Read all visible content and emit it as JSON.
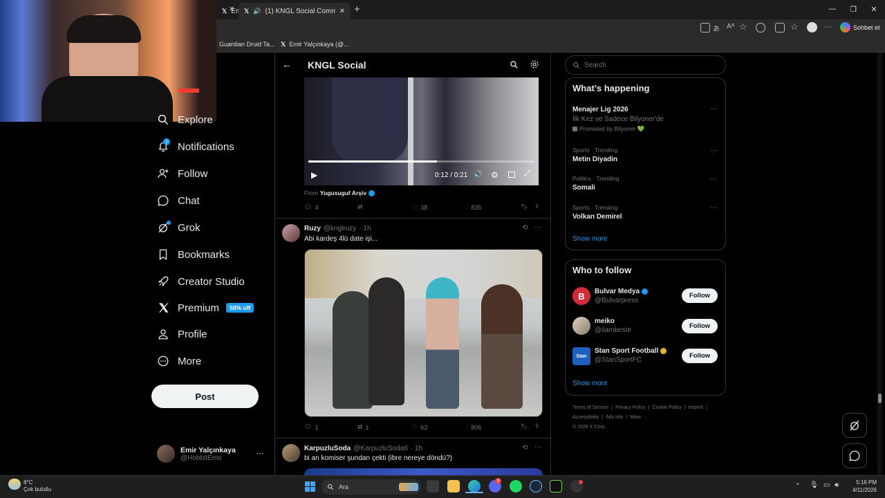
{
  "browser": {
    "tabs": [
      {
        "label": "Emi"
      },
      {
        "label": "(1) KNGL Social Community /"
      }
    ],
    "favorites": [
      {
        "label": "Guardian Druid Ta..."
      },
      {
        "label": "Emir Yalçınkaya (@..."
      }
    ],
    "copilot_label": "Sohbet et"
  },
  "nav": {
    "items": [
      {
        "label": "Explore"
      },
      {
        "label": "Notifications",
        "count": "1"
      },
      {
        "label": "Follow"
      },
      {
        "label": "Chat"
      },
      {
        "label": "Grok"
      },
      {
        "label": "Bookmarks"
      },
      {
        "label": "Creator Studio"
      },
      {
        "label": "Premium",
        "badge": "50% off"
      },
      {
        "label": "Profile"
      },
      {
        "label": "More"
      }
    ],
    "post_label": "Post",
    "account": {
      "name": "Emir Yalçınkaya",
      "handle": "@HobbitEmo"
    }
  },
  "header": {
    "title": "KNGL Social"
  },
  "video": {
    "time": "0:12 / 0:21",
    "progress": 0.57
  },
  "tweet1": {
    "from_prefix": "From",
    "from_name": "Yugusuguf Arşiv",
    "replies": "4",
    "retweets": "",
    "likes": "38",
    "views": "835"
  },
  "tweet2": {
    "name": "Ruzy",
    "handle": "@knglruzy",
    "time": "· 1h",
    "text": "Abi kardeş 4lü date işi...",
    "replies": "1",
    "retweets": "1",
    "likes": "63",
    "views": "806"
  },
  "tweet3": {
    "name": "KarpuzluSoda",
    "handle": "@KarpuzluSoda6",
    "time": "· 1h",
    "text": "bi an komiser şundan çekti (ibre nereye döndü?)"
  },
  "sidebar": {
    "search_placeholder": "Search",
    "happening": {
      "title": "What’s happening",
      "items": [
        {
          "title": "Menajer Lig 2026",
          "subtitle": "İlk Kez ve Sadece Bilyoner'de",
          "meta": "Promoted by Bilyoner 💚"
        },
        {
          "meta": "Sports · Trending",
          "title": "Metin Diyadin"
        },
        {
          "meta": "Politics · Trending",
          "title": "Somali"
        },
        {
          "meta": "Sports · Trending",
          "title": "Volkan Demirel"
        }
      ],
      "show_more": "Show more"
    },
    "who_to_follow": {
      "title": "Who to follow",
      "items": [
        {
          "name": "Bulvar Medya",
          "handle": "@Bulvarpress",
          "button": "Follow"
        },
        {
          "name": "meiko",
          "handle": "@iiambeste",
          "button": "Follow"
        },
        {
          "name": "Stan Sport Football",
          "handle": "@StanSportFC",
          "button": "Follow"
        }
      ],
      "show_more": "Show more"
    },
    "footer": {
      "links": [
        "Terms of Service",
        "Privacy Policy",
        "Cookie Policy",
        "Imprint",
        "Accessibility",
        "Ads info",
        "More ···"
      ],
      "copyright": "© 2026 X Corp."
    }
  },
  "taskbar": {
    "weather_temp": "8°C",
    "weather_desc": "Çok bulutlu",
    "search_label": "Ara",
    "time": "5:16 PM",
    "date": "4/11/2026",
    "discord_count": "9"
  },
  "colors": {
    "accent": "#1d9bf0",
    "background": "#000000",
    "verified": "#1d9bf0",
    "gold": "#e2b719"
  }
}
